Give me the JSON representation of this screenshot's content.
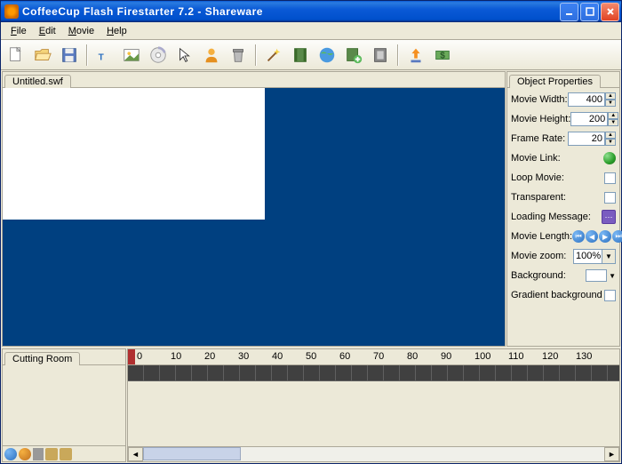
{
  "title": "CoffeeCup Flash Firestarter 7.2 - Shareware",
  "menu": {
    "file": "File",
    "edit": "Edit",
    "movie": "Movie",
    "help": "Help"
  },
  "tab": {
    "filename": "Untitled.swf"
  },
  "panel": {
    "title": "Object Properties",
    "rows": {
      "movie_width": {
        "label": "Movie Width:",
        "value": "400"
      },
      "movie_height": {
        "label": "Movie Height:",
        "value": "200"
      },
      "frame_rate": {
        "label": "Frame Rate:",
        "value": "20"
      },
      "movie_link": {
        "label": "Movie Link:"
      },
      "loop_movie": {
        "label": "Loop Movie:"
      },
      "transparent": {
        "label": "Transparent:"
      },
      "loading_msg": {
        "label": "Loading Message:"
      },
      "movie_length": {
        "label": "Movie Length:"
      },
      "movie_zoom": {
        "label": "Movie zoom:",
        "value": "100%"
      },
      "background": {
        "label": "Background:"
      },
      "gradient_bg": {
        "label": "Gradient background"
      }
    }
  },
  "cutting": {
    "title": "Cutting Room"
  },
  "timeline": {
    "ticks": [
      "0",
      "10",
      "20",
      "30",
      "40",
      "50",
      "60",
      "70",
      "80",
      "90",
      "100",
      "110",
      "120",
      "130"
    ]
  }
}
